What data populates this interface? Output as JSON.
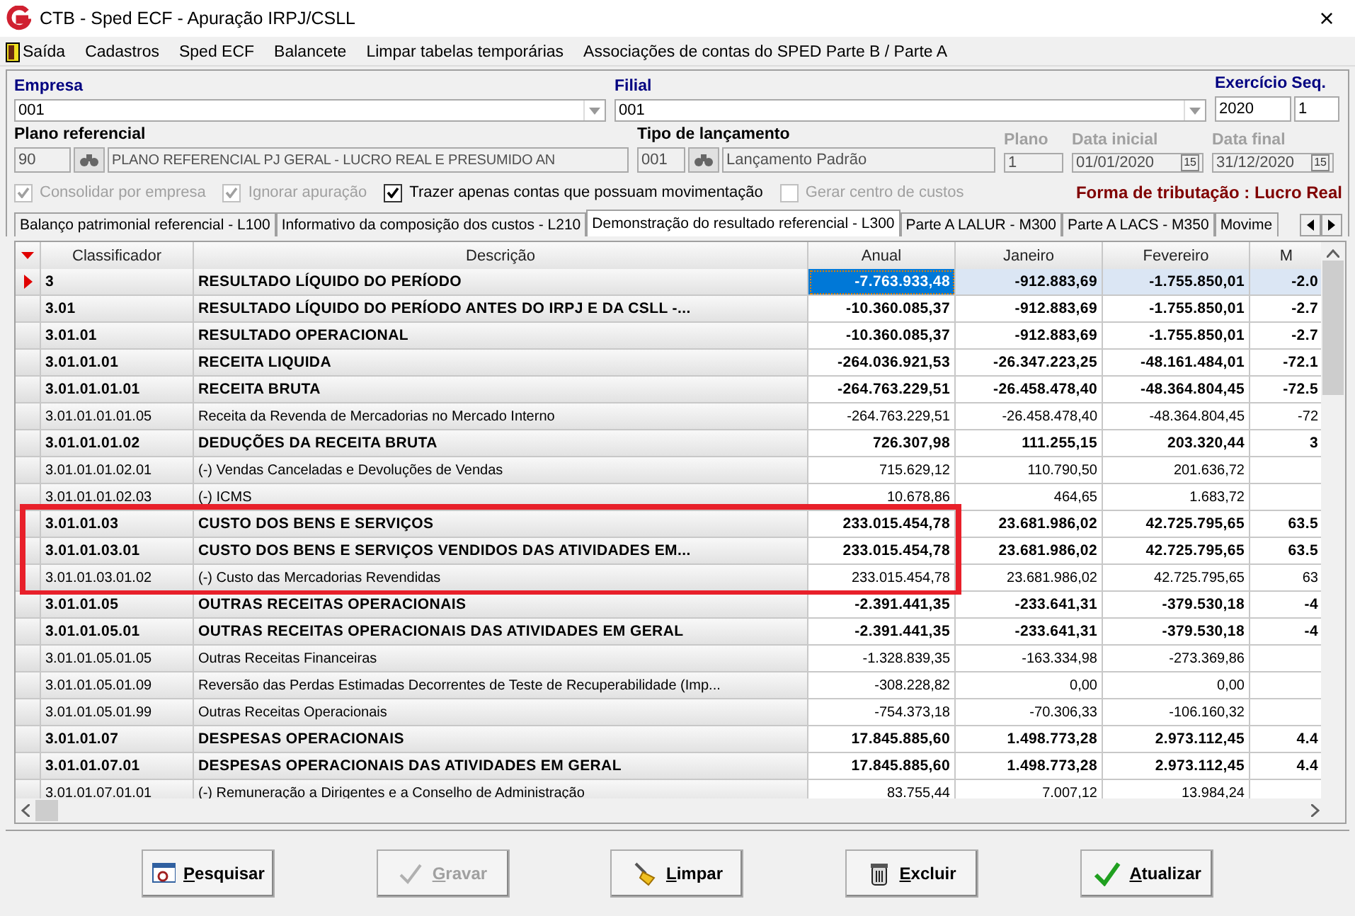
{
  "window": {
    "title": "CTB - Sped ECF - Apuração IRPJ/CSLL",
    "close": "×"
  },
  "menu": [
    {
      "label": "Saída",
      "kind": "exit"
    },
    {
      "label": "Cadastros"
    },
    {
      "label": "Sped ECF"
    },
    {
      "label": "Balancete"
    },
    {
      "label": "Limpar tabelas temporárias"
    },
    {
      "label": "Associações de contas do SPED Parte B / Parte A"
    }
  ],
  "form": {
    "empresa": {
      "label": "Empresa",
      "value": "001"
    },
    "filial": {
      "label": "Filial",
      "value": "001"
    },
    "exercicio": {
      "label": "Exercício",
      "value": "2020"
    },
    "seq": {
      "label": "Seq.",
      "value": "1"
    },
    "plano_referencial": {
      "label": "Plano referencial",
      "code": "90",
      "name": "PLANO REFERENCIAL PJ GERAL - LUCRO REAL E PRESUMIDO AN"
    },
    "tipo_lancamento": {
      "label": "Tipo de lançamento",
      "code": "001",
      "name": "Lançamento Padrão"
    },
    "plano": {
      "label": "Plano",
      "value": "1",
      "disabled": true
    },
    "data_inicial": {
      "label": "Data inicial",
      "value": "01/01/2020",
      "disabled": true,
      "calendar": "15"
    },
    "data_final": {
      "label": "Data final",
      "value": "31/12/2020",
      "disabled": true,
      "calendar": "15"
    }
  },
  "options": [
    {
      "label": "Consolidar por empresa",
      "checked": true,
      "disabled": true
    },
    {
      "label": "Ignorar apuração",
      "checked": true,
      "disabled": true
    },
    {
      "label": "Trazer apenas contas que possuam movimentação",
      "checked": true,
      "disabled": false
    },
    {
      "label": "Gerar centro de custos",
      "checked": false,
      "disabled": true
    }
  ],
  "tributacao": "Forma de tributação : Lucro Real",
  "tabs": [
    {
      "label": "Balanço patrimonial referencial - L100",
      "selected": false
    },
    {
      "label": "Informativo da composição dos custos - L210",
      "selected": false
    },
    {
      "label": "Demonstração do resultado referencial - L300",
      "selected": true
    },
    {
      "label": "Parte A LALUR - M300",
      "selected": false
    },
    {
      "label": "Parte A LACS - M350",
      "selected": false
    },
    {
      "label": "Movime",
      "selected": false
    }
  ],
  "table": {
    "columns": [
      "Classificador",
      "Descrição",
      "Anual",
      "Janeiro",
      "Fevereiro",
      "M"
    ],
    "rows": [
      {
        "kind": "group",
        "selected": true,
        "highlighted": false,
        "cells": [
          "3",
          "RESULTADO LÍQUIDO DO PERÍODO",
          "-7.763.933,48",
          "-912.883,69",
          "-1.755.850,01",
          "-2.0"
        ]
      },
      {
        "kind": "group",
        "selected": false,
        "highlighted": false,
        "cells": [
          "3.01",
          "RESULTADO LÍQUIDO DO PERÍODO ANTES DO IRPJ E DA CSLL -...",
          "-10.360.085,37",
          "-912.883,69",
          "-1.755.850,01",
          "-2.7"
        ]
      },
      {
        "kind": "group",
        "selected": false,
        "highlighted": false,
        "cells": [
          "3.01.01",
          "RESULTADO OPERACIONAL",
          "-10.360.085,37",
          "-912.883,69",
          "-1.755.850,01",
          "-2.7"
        ]
      },
      {
        "kind": "group",
        "selected": false,
        "highlighted": false,
        "cells": [
          "3.01.01.01",
          "RECEITA LIQUIDA",
          "-264.036.921,53",
          "-26.347.223,25",
          "-48.161.484,01",
          "-72.1"
        ]
      },
      {
        "kind": "group",
        "selected": false,
        "highlighted": false,
        "cells": [
          "3.01.01.01.01",
          "RECEITA BRUTA",
          "-264.763.229,51",
          "-26.458.478,40",
          "-48.364.804,45",
          "-72.5"
        ]
      },
      {
        "kind": "account",
        "selected": false,
        "highlighted": false,
        "cells": [
          "3.01.01.01.01.05",
          "Receita da Revenda de Mercadorias no Mercado Interno",
          "-264.763.229,51",
          "-26.458.478,40",
          "-48.364.804,45",
          "-72"
        ]
      },
      {
        "kind": "group",
        "selected": false,
        "highlighted": false,
        "cells": [
          "3.01.01.01.02",
          "DEDUÇÕES DA RECEITA BRUTA",
          "726.307,98",
          "111.255,15",
          "203.320,44",
          "3"
        ]
      },
      {
        "kind": "account",
        "selected": false,
        "highlighted": false,
        "cells": [
          "3.01.01.01.02.01",
          " (-) Vendas Canceladas e Devoluções de Vendas",
          "715.629,12",
          "110.790,50",
          "201.636,72",
          ""
        ]
      },
      {
        "kind": "account",
        "selected": false,
        "highlighted": false,
        "cells": [
          "3.01.01.01.02.03",
          " (-) ICMS",
          "10.678,86",
          "464,65",
          "1.683,72",
          ""
        ]
      },
      {
        "kind": "group",
        "selected": false,
        "highlighted": true,
        "cells": [
          "3.01.01.03",
          "CUSTO DOS BENS E SERVIÇOS",
          "233.015.454,78",
          "23.681.986,02",
          "42.725.795,65",
          "63.5"
        ]
      },
      {
        "kind": "group",
        "selected": false,
        "highlighted": true,
        "cells": [
          "3.01.01.03.01",
          "CUSTO DOS BENS E SERVIÇOS VENDIDOS DAS ATIVIDADES EM...",
          "233.015.454,78",
          "23.681.986,02",
          "42.725.795,65",
          "63.5"
        ]
      },
      {
        "kind": "account",
        "selected": false,
        "highlighted": true,
        "cells": [
          "3.01.01.03.01.02",
          " (-) Custo das Mercadorias Revendidas",
          "233.015.454,78",
          "23.681.986,02",
          "42.725.795,65",
          "63"
        ]
      },
      {
        "kind": "group",
        "selected": false,
        "highlighted": false,
        "cells": [
          "3.01.01.05",
          "OUTRAS RECEITAS OPERACIONAIS",
          "-2.391.441,35",
          "-233.641,31",
          "-379.530,18",
          "-4"
        ]
      },
      {
        "kind": "group",
        "selected": false,
        "highlighted": false,
        "cells": [
          "3.01.01.05.01",
          "OUTRAS RECEITAS OPERACIONAIS DAS ATIVIDADES EM GERAL",
          "-2.391.441,35",
          "-233.641,31",
          "-379.530,18",
          "-4"
        ]
      },
      {
        "kind": "account",
        "selected": false,
        "highlighted": false,
        "cells": [
          "3.01.01.05.01.05",
          "Outras Receitas Financeiras",
          "-1.328.839,35",
          "-163.334,98",
          "-273.369,86",
          ""
        ]
      },
      {
        "kind": "account",
        "selected": false,
        "highlighted": false,
        "cells": [
          "3.01.01.05.01.09",
          "Reversão das Perdas Estimadas Decorrentes de Teste de Recuperabilidade (Imp...",
          "-308.228,82",
          "0,00",
          "0,00",
          ""
        ]
      },
      {
        "kind": "account",
        "selected": false,
        "highlighted": false,
        "cells": [
          "3.01.01.05.01.99",
          "Outras Receitas Operacionais",
          "-754.373,18",
          "-70.306,33",
          "-106.160,32",
          ""
        ]
      },
      {
        "kind": "group",
        "selected": false,
        "highlighted": false,
        "cells": [
          "3.01.01.07",
          "DESPESAS OPERACIONAIS",
          "17.845.885,60",
          "1.498.773,28",
          "2.973.112,45",
          "4.4"
        ]
      },
      {
        "kind": "group",
        "selected": false,
        "highlighted": false,
        "cells": [
          "3.01.01.07.01",
          "DESPESAS OPERACIONAIS DAS ATIVIDADES EM GERAL",
          "17.845.885,60",
          "1.498.773,28",
          "2.973.112,45",
          "4.4"
        ]
      },
      {
        "kind": "account",
        "selected": false,
        "highlighted": false,
        "cells": [
          "3.01.01.07.01.01",
          " (-) Remuneração a Dirigentes e a Conselho de Administração",
          "83.755,44",
          "7.007,12",
          "13.984,24",
          ""
        ]
      }
    ]
  },
  "buttons": [
    {
      "label": "Pesquisar",
      "kind": "search",
      "disabled": false
    },
    {
      "label": "Gravar",
      "kind": "save",
      "disabled": true
    },
    {
      "label": "Limpar",
      "kind": "clear",
      "disabled": false
    },
    {
      "label": "Excluir",
      "kind": "delete",
      "disabled": false
    },
    {
      "label": "Atualizar",
      "kind": "update",
      "disabled": false
    }
  ]
}
